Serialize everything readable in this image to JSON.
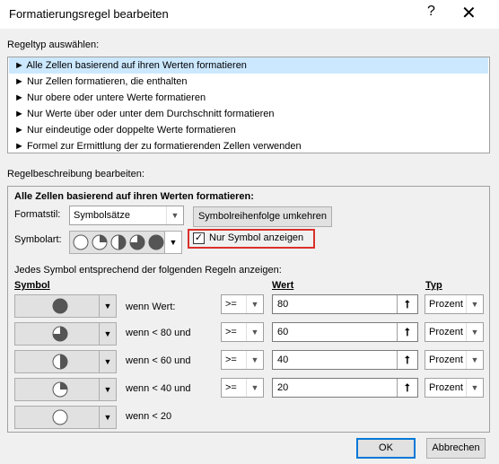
{
  "window": {
    "title": "Formatierungsregel bearbeiten",
    "help": "?",
    "close": "✕"
  },
  "ruletype": {
    "label": "Regeltyp auswählen:",
    "items": [
      "► Alle Zellen basierend auf ihren Werten formatieren",
      "► Nur Zellen formatieren, die enthalten",
      "► Nur obere oder untere Werte formatieren",
      "► Nur Werte über oder unter dem Durchschnitt formatieren",
      "► Nur eindeutige oder doppelte Werte formatieren",
      "► Formel zur Ermittlung der zu formatierenden Zellen verwenden"
    ],
    "selected_index": 0
  },
  "desc": {
    "label": "Regelbeschreibung bearbeiten:",
    "heading": "Alle Zellen basierend auf ihren Werten formatieren:",
    "formatstil_label": "Formatstil:",
    "formatstil_value": "Symbolsätze",
    "reverse_button": "Symbolreihenfolge umkehren",
    "symbolart_label": "Symbolart:",
    "only_symbol_label": "Nur Symbol anzeigen",
    "only_symbol_checked": "✓",
    "rules_intro": "Jedes Symbol entsprechend der folgenden Regeln anzeigen:",
    "col_symbol": "Symbol",
    "col_wert": "Wert",
    "col_typ": "Typ",
    "rows": [
      {
        "condition": "wenn Wert:",
        "op": ">=",
        "value": "80",
        "type": "Prozent",
        "fill": 1.0
      },
      {
        "condition": "wenn < 80 und",
        "op": ">=",
        "value": "60",
        "type": "Prozent",
        "fill": 0.75
      },
      {
        "condition": "wenn < 60 und",
        "op": ">=",
        "value": "40",
        "type": "Prozent",
        "fill": 0.5
      },
      {
        "condition": "wenn < 40 und",
        "op": ">=",
        "value": "20",
        "type": "Prozent",
        "fill": 0.25
      },
      {
        "condition": "wenn < 20",
        "fill": 0.0
      }
    ]
  },
  "buttons": {
    "ok": "OK",
    "cancel": "Abbrechen"
  },
  "colors": {
    "selection": "#cce8ff",
    "highlight": "#d9312b",
    "ok_border": "#0078d7"
  }
}
